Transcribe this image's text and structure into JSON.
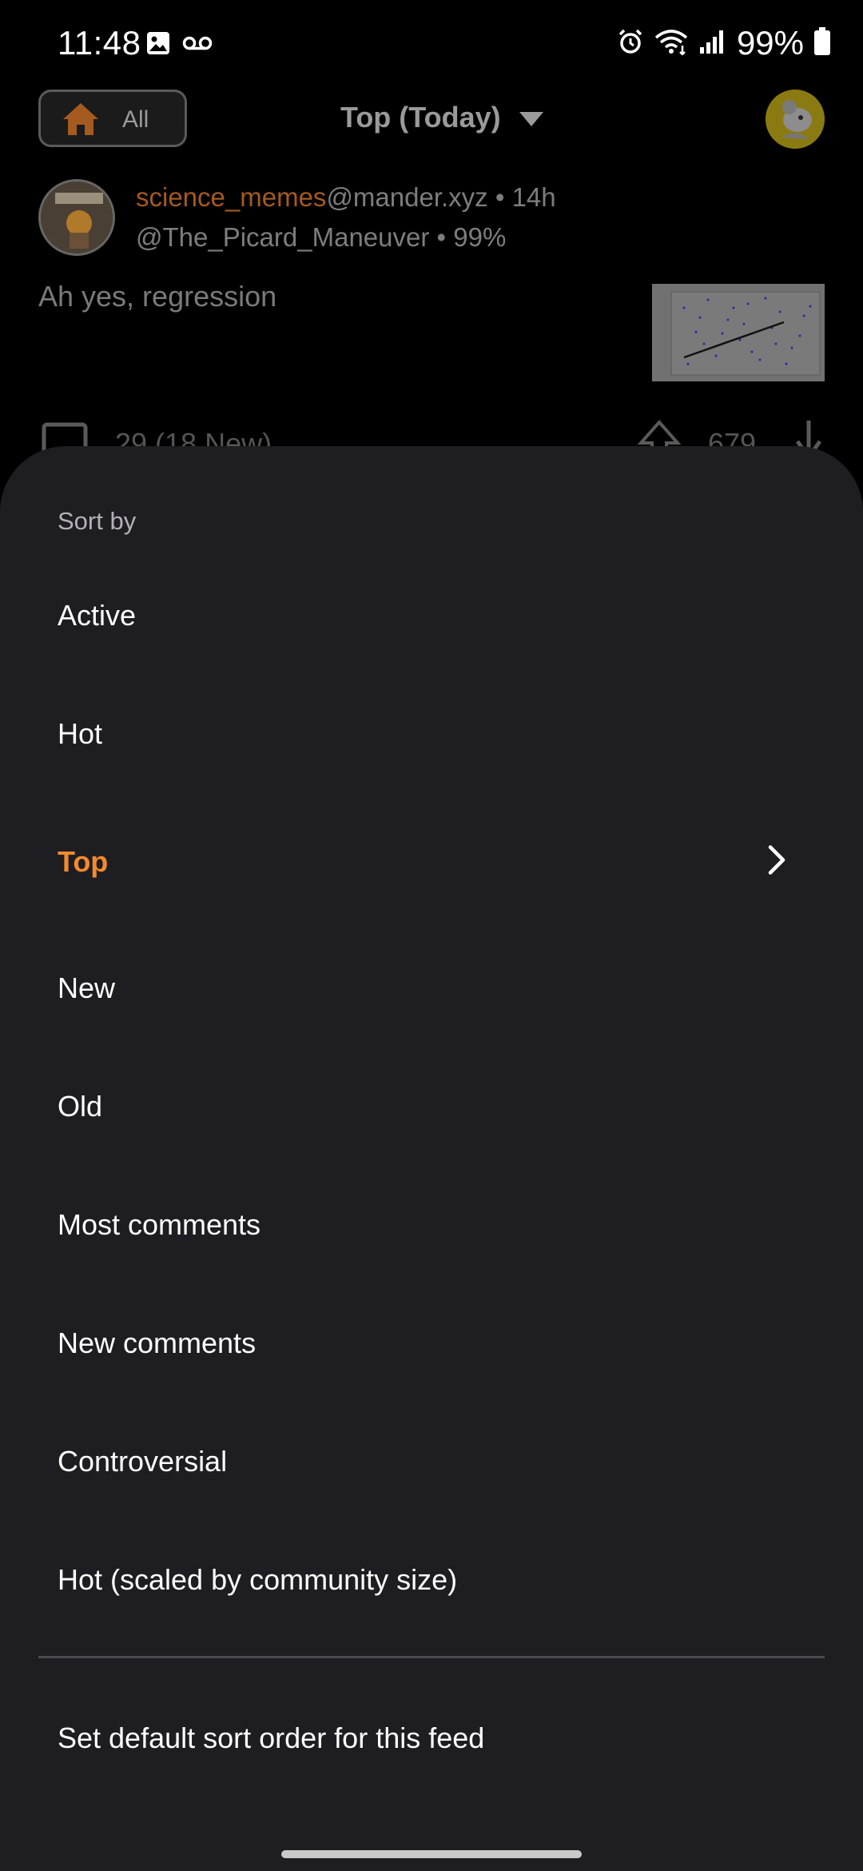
{
  "status_bar": {
    "time": "11:48",
    "battery": "99%"
  },
  "header": {
    "feed_label": "All",
    "sort_title": "Top (Today)"
  },
  "post": {
    "community": "science_memes",
    "instance": "@mander.xyz",
    "age": "14h",
    "author": "@The_Picard_Maneuver",
    "upvote_ratio": "99%",
    "title": "Ah yes, regression",
    "comments": "29 (18 New)",
    "score": "679"
  },
  "sheet": {
    "title": "Sort by",
    "options": [
      {
        "label": "Active"
      },
      {
        "label": "Hot"
      },
      {
        "label": "Top"
      },
      {
        "label": "New"
      },
      {
        "label": "Old"
      },
      {
        "label": "Most comments"
      },
      {
        "label": "New comments"
      },
      {
        "label": "Controversial"
      },
      {
        "label": "Hot (scaled by community size)"
      }
    ],
    "selected": "Top",
    "footer_action": "Set default sort order for this feed"
  },
  "colors": {
    "accent": "#f28a2e",
    "sheet_bg": "#1e1d22"
  }
}
